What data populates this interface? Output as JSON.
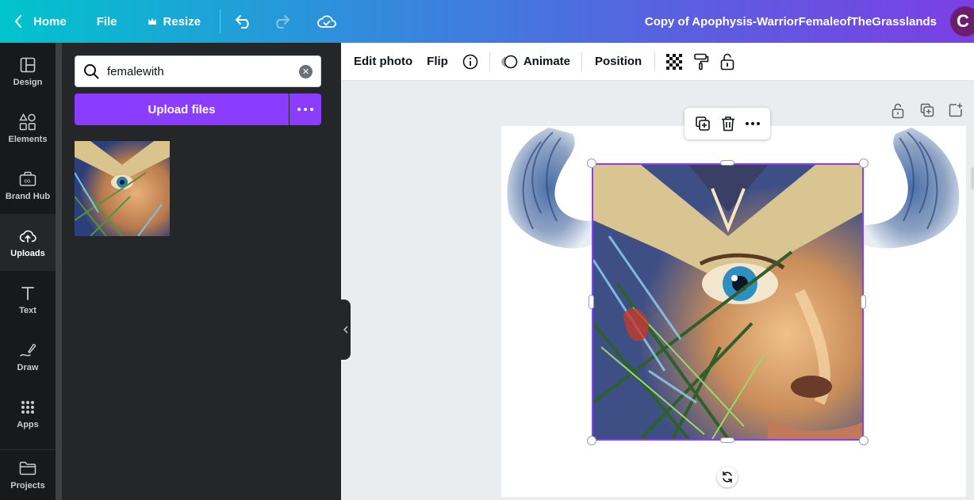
{
  "topbar": {
    "home_label": "Home",
    "file_label": "File",
    "resize_label": "Resize",
    "doc_title": "Copy of Apophysis-WarriorFemaleofTheGrasslands",
    "avatar_initial": "C"
  },
  "rail": {
    "items": [
      {
        "label": "Design",
        "icon": "design-icon"
      },
      {
        "label": "Elements",
        "icon": "elements-icon"
      },
      {
        "label": "Brand Hub",
        "icon": "brand-hub-icon"
      },
      {
        "label": "Uploads",
        "icon": "upload-cloud-icon",
        "active": true
      },
      {
        "label": "Text",
        "icon": "text-icon"
      },
      {
        "label": "Draw",
        "icon": "draw-icon"
      },
      {
        "label": "Apps",
        "icon": "apps-icon"
      },
      {
        "label": "Projects",
        "icon": "folder-icon"
      }
    ],
    "brand_hub_icon_text": "CO."
  },
  "panel": {
    "search_value": "femalewith",
    "upload_label": "Upload files"
  },
  "context_toolbar": {
    "edit_photo": "Edit photo",
    "flip": "Flip",
    "animate": "Animate",
    "position": "Position"
  },
  "colors": {
    "accent": "#8b3dff",
    "dark_panel": "#252627",
    "rail": "#18191b",
    "canvas_bg": "#ebecf0"
  }
}
